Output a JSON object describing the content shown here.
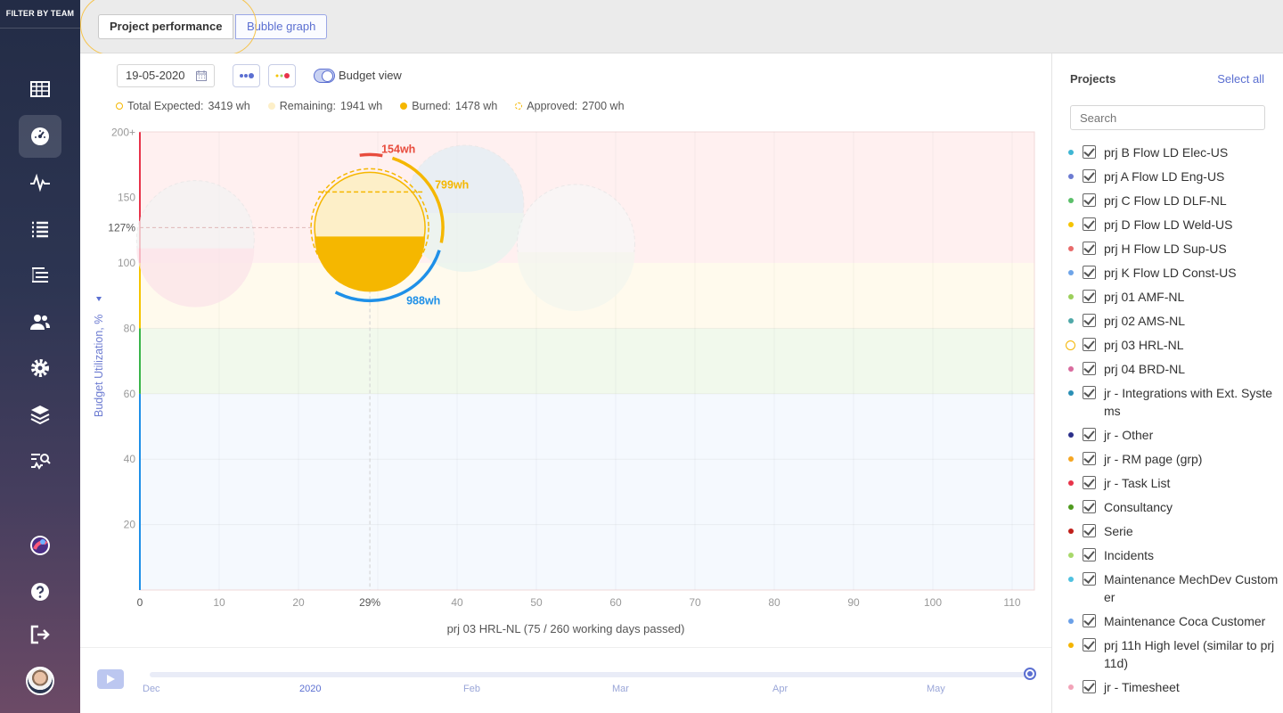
{
  "sidebar": {
    "filter_label": "FILTER BY TEAM",
    "items": [
      {
        "icon": "grid-icon"
      },
      {
        "icon": "gauge-icon",
        "active": true
      },
      {
        "icon": "activity-icon"
      },
      {
        "icon": "list-icon"
      },
      {
        "icon": "tree-list-icon"
      },
      {
        "icon": "users-icon"
      },
      {
        "icon": "gear-icon"
      },
      {
        "icon": "layers-icon"
      },
      {
        "icon": "search-activity-icon"
      }
    ],
    "bottom": [
      {
        "icon": "app-logo-icon"
      },
      {
        "icon": "help-icon"
      },
      {
        "icon": "logout-icon"
      },
      {
        "icon": "user-avatar"
      }
    ]
  },
  "tabs": {
    "performance": "Project performance",
    "bubble": "Bubble graph"
  },
  "toolbar": {
    "date": "19-05-2020",
    "budget_view_label": "Budget view"
  },
  "legend": {
    "total_label": "Total Expected:",
    "total_value": "3419 wh",
    "remaining_label": "Remaining:",
    "remaining_value": "1941 wh",
    "burned_label": "Burned:",
    "burned_value": "1478 wh",
    "approved_label": "Approved:",
    "approved_value": "2700 wh"
  },
  "colors": {
    "accent": "#5b6fd1",
    "burned": "#f5b700",
    "remaining": "#fdefc8",
    "over": "#e84c3d",
    "approved": "#1e90e8"
  },
  "chart_data": {
    "type": "scatter",
    "ylabel": "Budget Utilization, %",
    "xlabel": "prj 03 HRL-NL (75 / 260 working days passed)",
    "x_ticks": [
      0,
      10,
      20,
      40,
      50,
      60,
      70,
      80,
      90,
      100,
      110
    ],
    "x_highlight": "29%",
    "y_ticks": [
      20,
      40,
      60,
      80,
      100,
      150,
      "200+"
    ],
    "y_highlight": "127%",
    "zones": [
      {
        "from": 0,
        "to": 60,
        "color": "#f5f9fe"
      },
      {
        "from": 60,
        "to": 80,
        "color": "#f1f9ec"
      },
      {
        "from": 80,
        "to": 100,
        "color": "#fffaed"
      },
      {
        "from": 100,
        "to": 200,
        "color": "#fff0f0"
      }
    ],
    "focus": {
      "project": "prj 03 HRL-NL",
      "x": 29,
      "y": 127,
      "labels": {
        "over": "154wh",
        "remaining": "799wh",
        "approved": "988wh"
      }
    },
    "bubbles": [
      {
        "x": 7,
        "y": 118
      },
      {
        "x": 41,
        "y": 145
      },
      {
        "x": 55,
        "y": 115
      }
    ]
  },
  "timeline": {
    "labels": [
      "Dec",
      "2020",
      "Feb",
      "Mar",
      "Apr",
      "May"
    ]
  },
  "projects": {
    "title": "Projects",
    "select_all": "Select all",
    "search_placeholder": "Search",
    "items": [
      {
        "label": "prj B Flow LD Elec-US",
        "color": "#3fb6d3"
      },
      {
        "label": "prj A Flow LD Eng-US",
        "color": "#6c7bd1"
      },
      {
        "label": "prj C Flow LD DLF-NL",
        "color": "#5bbf6a"
      },
      {
        "label": "prj D Flow LD Weld-US",
        "color": "#f5c400"
      },
      {
        "label": "prj H Flow LD Sup-US",
        "color": "#e86a6a"
      },
      {
        "label": "prj K Flow LD Const-US",
        "color": "#6ea4e8"
      },
      {
        "label": "prj 01 AMF-NL",
        "color": "#9ccf5b"
      },
      {
        "label": "prj 02 AMS-NL",
        "color": "#4fa8a8"
      },
      {
        "label": "prj 03 HRL-NL",
        "color": "#f4b400",
        "ring": true
      },
      {
        "label": "prj 04 BRD-NL",
        "color": "#d96b9e"
      },
      {
        "label": "jr - Integrations with Ext. Systems",
        "color": "#2a8fb5"
      },
      {
        "label": "jr - Other",
        "color": "#2b2f8a"
      },
      {
        "label": "jr - RM page (grp)",
        "color": "#f5a623"
      },
      {
        "label": "jr - Task List",
        "color": "#e8334a"
      },
      {
        "label": "Consultancy",
        "color": "#4f9a1e"
      },
      {
        "label": "Serie",
        "color": "#c0201a"
      },
      {
        "label": "Incidents",
        "color": "#a8d86b"
      },
      {
        "label": "Maintenance MechDev Customer",
        "color": "#4fc1e0"
      },
      {
        "label": "Maintenance Coca Customer",
        "color": "#6aa0e8"
      },
      {
        "label": "prj 11h High level (similar to prj 11d)",
        "color": "#f4b400"
      },
      {
        "label": "jr - Timesheet",
        "color": "#f2a3b8"
      }
    ]
  }
}
